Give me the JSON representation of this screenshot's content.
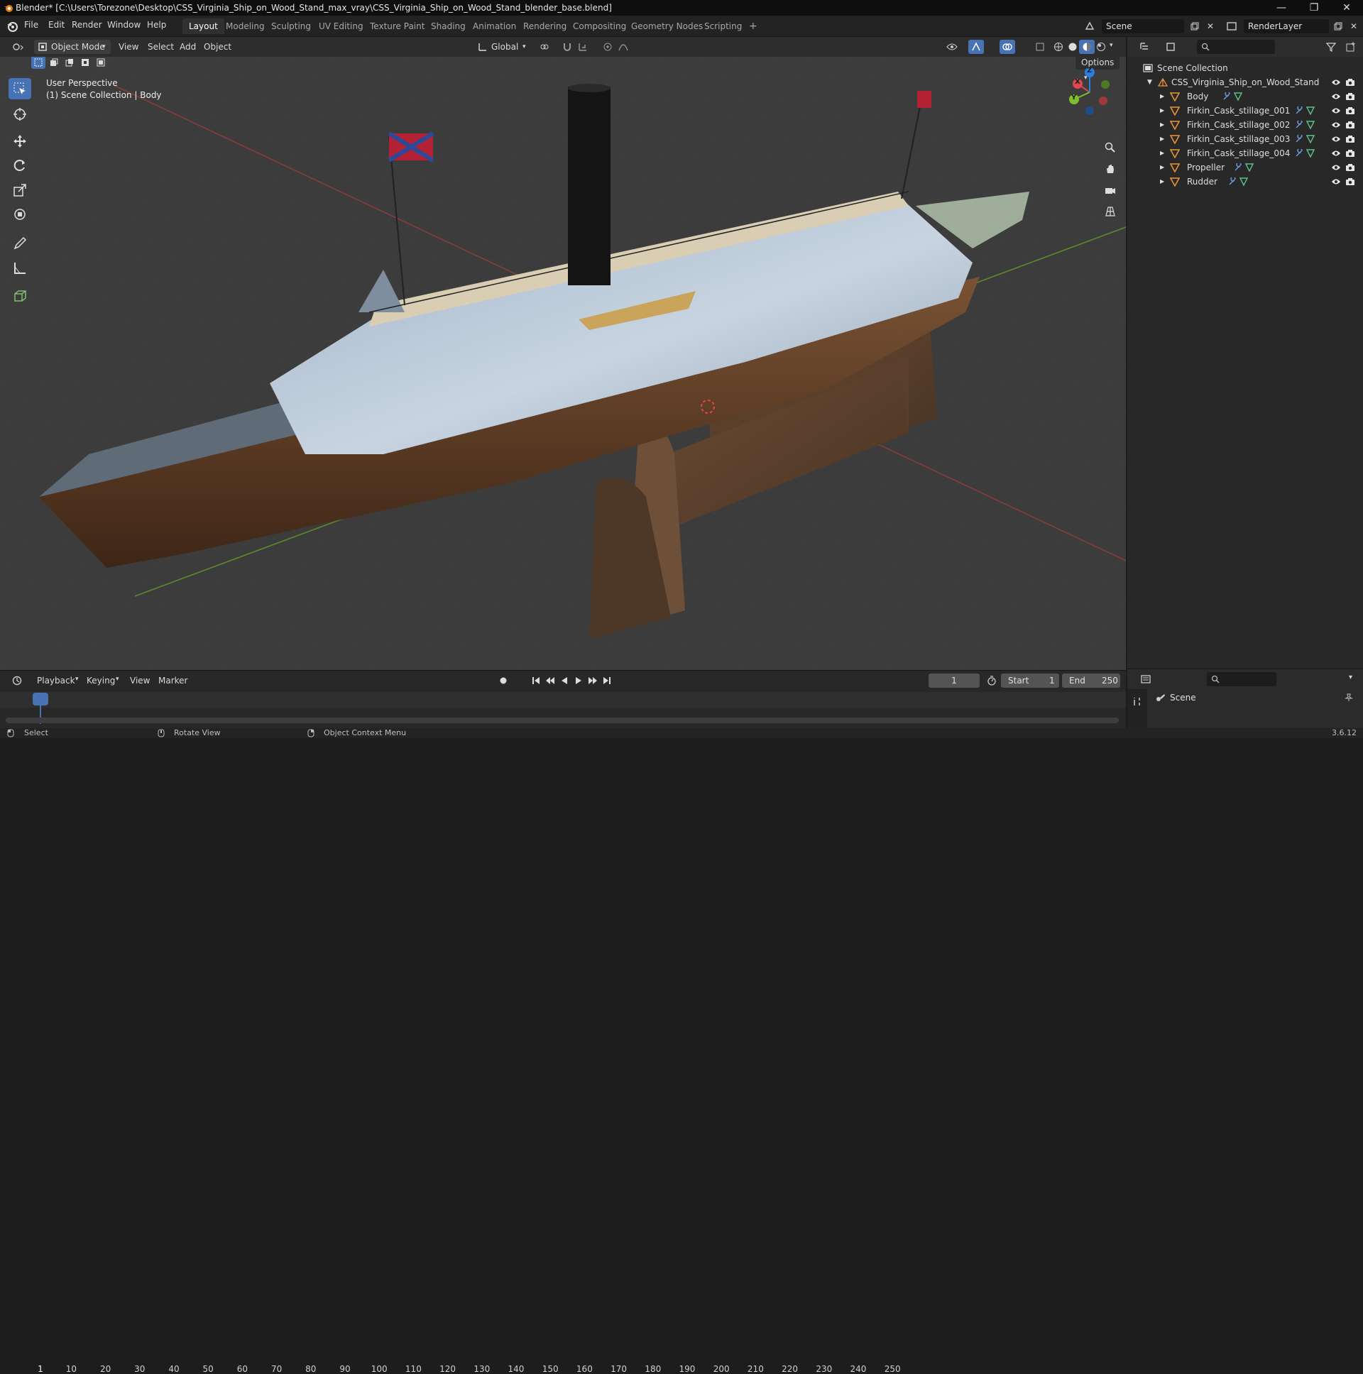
{
  "window": {
    "title": "Blender* [C:\\Users\\Torezone\\Desktop\\CSS_Virginia_Ship_on_Wood_Stand_max_vray\\CSS_Virginia_Ship_on_Wood_Stand_blender_base.blend]",
    "minimize": "—",
    "maximize": "❐",
    "close": "✕"
  },
  "menu": [
    "File",
    "Edit",
    "Render",
    "Window",
    "Help"
  ],
  "workspaces": [
    "Layout",
    "Modeling",
    "Sculpting",
    "UV Editing",
    "Texture Paint",
    "Shading",
    "Animation",
    "Rendering",
    "Compositing",
    "Geometry Nodes",
    "Scripting"
  ],
  "workspace_add": "+",
  "scene_field": "Scene",
  "renderlayer_field": "RenderLayer",
  "viewport_header": {
    "mode": "Object Mode",
    "menus": [
      "View",
      "Select",
      "Add",
      "Object"
    ],
    "orientation": "Global",
    "options": "Options"
  },
  "viewport_overlay": {
    "perspective": "User Perspective",
    "collection": "(1) Scene Collection | Body"
  },
  "gizmo": {
    "x": "X",
    "y": "Y",
    "z": "Z"
  },
  "outliner": {
    "root": "Scene Collection",
    "collection": "CSS_Virginia_Ship_on_Wood_Stand",
    "objects": [
      "Body",
      "Firkin_Cask_stillage_001",
      "Firkin_Cask_stillage_002",
      "Firkin_Cask_stillage_003",
      "Firkin_Cask_stillage_004",
      "Propeller",
      "Rudder"
    ]
  },
  "timeline": {
    "menus": [
      "Playback",
      "Keying",
      "View",
      "Marker"
    ],
    "current_frame": "1",
    "start_label": "Start",
    "start_value": "1",
    "end_label": "End",
    "end_value": "250",
    "ticks": [
      "1",
      "10",
      "20",
      "30",
      "40",
      "50",
      "60",
      "70",
      "80",
      "90",
      "100",
      "110",
      "120",
      "130",
      "140",
      "150",
      "160",
      "170",
      "180",
      "190",
      "200",
      "210",
      "220",
      "230",
      "240",
      "250"
    ]
  },
  "properties": {
    "scene": "Scene"
  },
  "statusbar": {
    "select": "Select",
    "rotate": "Rotate View",
    "context": "Object Context Menu",
    "version": "3.6.12"
  },
  "colors": {
    "accent": "#4772b3",
    "x_axis": "#e0464f",
    "y_axis": "#7ebe2c",
    "z_axis": "#2b7de0"
  }
}
